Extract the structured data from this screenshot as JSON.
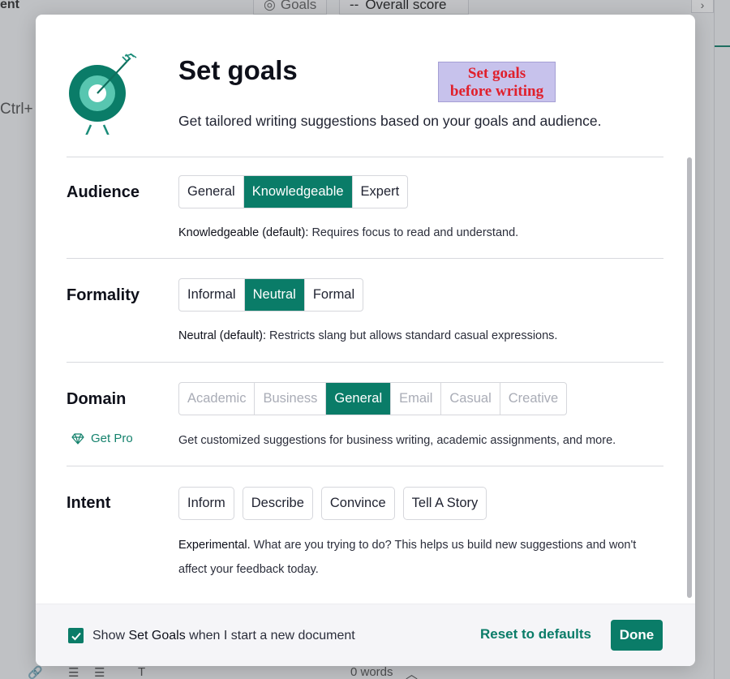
{
  "background": {
    "doc_title_fragment": "ent",
    "goals_label": "Goals",
    "overall_score_dash": "--",
    "overall_score_label": "Overall score",
    "shortcut_fragment": "Ctrl+",
    "word_count": "0 words",
    "chevron_icon": "chevron-right-icon"
  },
  "modal": {
    "title": "Set goals",
    "subtitle": "Get tailored writing suggestions based on your goals and audience.",
    "stamp_line1": "Set goals",
    "stamp_line2": "before writing",
    "logo_icon": "target-arrow-icon",
    "accent_color": "#0a7c68",
    "sections": {
      "audience": {
        "label": "Audience",
        "options": [
          "General",
          "Knowledgeable",
          "Expert"
        ],
        "selected": "Knowledgeable",
        "desc_bold": "Knowledgeable (default):",
        "desc_text": " Requires focus to read and understand."
      },
      "formality": {
        "label": "Formality",
        "options": [
          "Informal",
          "Neutral",
          "Formal"
        ],
        "selected": "Neutral",
        "desc_bold": "Neutral (default):",
        "desc_text": " Restricts slang but allows standard casual expressions."
      },
      "domain": {
        "label": "Domain",
        "get_pro": "Get Pro",
        "get_pro_icon": "diamond-icon",
        "options": [
          "Academic",
          "Business",
          "General",
          "Email",
          "Casual",
          "Creative"
        ],
        "selected": "General",
        "desc_text": "Get customized suggestions for business writing, academic assignments, and more."
      },
      "intent": {
        "label": "Intent",
        "options": [
          "Inform",
          "Describe",
          "Convince",
          "Tell A Story"
        ],
        "desc_bold": "Experimental.",
        "desc_text": " What are you trying to do? This helps us build new suggestions and won't affect your feedback today."
      }
    },
    "footer": {
      "checkbox_checked": true,
      "checkbox_prefix": "Show ",
      "checkbox_emph": "Set Goals",
      "checkbox_suffix": " when I start a new document",
      "reset_label": "Reset to defaults",
      "done_label": "Done"
    }
  }
}
